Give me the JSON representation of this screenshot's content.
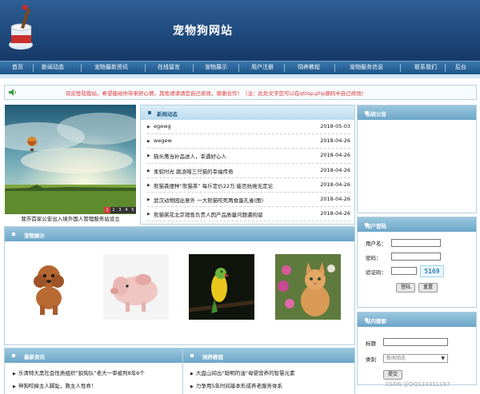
{
  "site": {
    "title": "宠物狗网站"
  },
  "nav": {
    "items": [
      "首页",
      "新闻动态",
      "宠物最新资讯",
      "在线留言",
      "宠物展示",
      "用户注册",
      "饲养教程",
      "宠物服务信息",
      "联系我们",
      "后台"
    ]
  },
  "notice": {
    "text": "欢迎登陆我站，希望能给你带来好心情，其他请请请您自己修改，谢谢合作！（注：此处文字您可以在qttop.php源码中自己修改）"
  },
  "slideshow": {
    "caption": "我市首家公安出入境外国人管理服务站设立",
    "pages": [
      "1",
      "2",
      "3",
      "4",
      "5"
    ],
    "active_page": "1"
  },
  "news": {
    "title": "新闻动态",
    "items": [
      {
        "title": "egewg",
        "date": "2018-05-03"
      },
      {
        "title": "wegew",
        "date": "2018-04-26"
      },
      {
        "title": "猫头鹰当补品送人，幸遇好心人",
        "date": "2018-04-26"
      },
      {
        "title": "柔软时光 跳浪喵三只猫的幸福传奇",
        "date": "2018-04-26"
      },
      {
        "title": "熊猫粪便种“熊猫茶” 每斤定价22万 能否抗癌无定论",
        "date": "2018-04-26"
      },
      {
        "title": "武汉动物园出意外 一大熊猫咬死两食蛋孔雀(图)",
        "date": "2018-04-26"
      },
      {
        "title": "熊猫粥花北京销售负责人因产品质量问题遭拘留",
        "date": "2018-04-26"
      }
    ]
  },
  "site_notice": {
    "title": "系统公告"
  },
  "pets": {
    "title": "宠物展示"
  },
  "login": {
    "title": "用户登陆",
    "username_label": "用户名：",
    "password_label": "密码：",
    "captcha_label": "验证码：",
    "captcha_value": "5169",
    "login_button": "登陆",
    "reset_button": "重置"
  },
  "search": {
    "title": "站内搜索",
    "title_label": "标题",
    "category_label": "类别",
    "category_value": "新闻动态",
    "submit_button": "提交"
  },
  "latest": {
    "title": "最新资讯",
    "items": [
      "乐清特大黑社会性质组织“狼狗队”老大一审被判8年6个",
      "神狗咬掉主人脚趾，救主人性命！"
    ]
  },
  "tutorial": {
    "title": "饲养教程",
    "items": [
      "大盘山间出“聪明的油”母婴营养的智慧元素",
      "力争用5年时间基本形成养老服务体系"
    ]
  },
  "watermark": "CSDN @QQ123311197"
}
